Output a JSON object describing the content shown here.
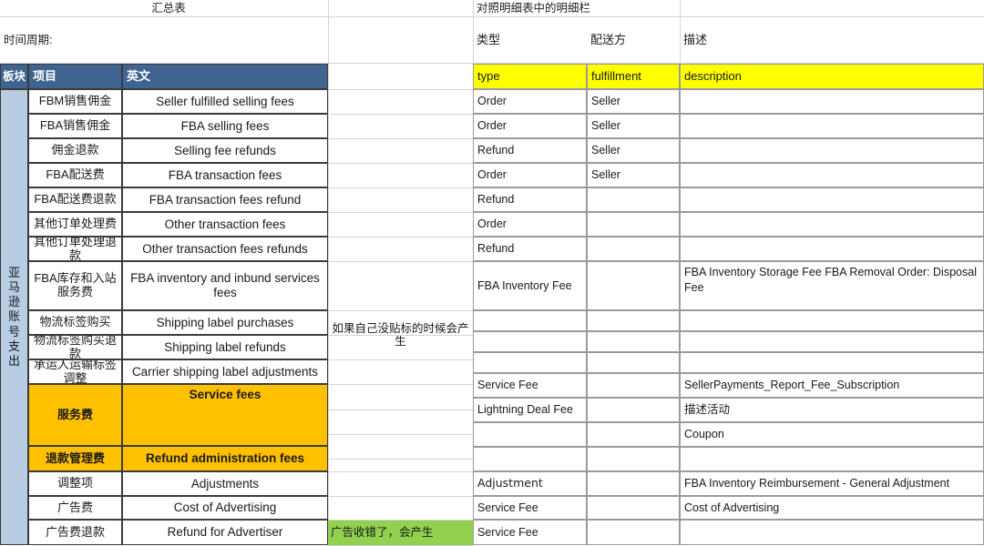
{
  "sheet": {
    "section_headers": {
      "summary_table": "汇总表",
      "detail_reference": "对照明细表中的明细栏",
      "time_period": "时间周期:"
    },
    "left_table": {
      "headers": {
        "block": "板块",
        "item": "项目",
        "english": "英文"
      },
      "block_label": "亚马逊账号支出",
      "rows": [
        {
          "item": "FBM销售佣金",
          "english": "Seller fulfilled selling fees",
          "fill": "white"
        },
        {
          "item": "FBA销售佣金",
          "english": "FBA selling fees",
          "fill": "white"
        },
        {
          "item": "佣金退款",
          "english": "Selling fee refunds",
          "fill": "white"
        },
        {
          "item": "FBA配送费",
          "english": "FBA transaction fees",
          "fill": "white"
        },
        {
          "item": "FBA配送费退款",
          "english": "FBA transaction fees refund",
          "fill": "white"
        },
        {
          "item": "其他订单处理费",
          "english": "Other transaction fees",
          "fill": "white"
        },
        {
          "item": "其他订单处理退款",
          "english": "Other transaction fees refunds",
          "fill": "white"
        },
        {
          "item": "FBA库存和入站服务费",
          "english": "FBA inventory and inbund services fees",
          "fill": "white"
        },
        {
          "item": "物流标签购买",
          "english": "Shipping label purchases",
          "fill": "white"
        },
        {
          "item": "物流标签购买退款",
          "english": "Shipping label refunds",
          "fill": "white"
        },
        {
          "item": "承运人运输标签调整",
          "english": "Carrier shipping label adjustments",
          "fill": "white"
        },
        {
          "item": "服务费",
          "english": "Service fees",
          "fill": "orange"
        },
        {
          "item": "退款管理费",
          "english": "Refund administration fees",
          "fill": "orange"
        },
        {
          "item": "调整项",
          "english": "Adjustments",
          "fill": "white"
        },
        {
          "item": "广告费",
          "english": "Cost of Advertising",
          "fill": "white"
        },
        {
          "item": "广告费退款",
          "english": "Refund for Advertiser",
          "fill": "white"
        }
      ]
    },
    "notes_column": {
      "shipping_label_note": "如果自己没贴标的时候会产生",
      "advertising_note": "广告收错了，会产生"
    },
    "right_table": {
      "cn_headers": {
        "type": "类型",
        "fulfillment": "配送方",
        "description": "描述"
      },
      "en_headers": {
        "type": "type",
        "fulfillment": "fulfillment",
        "description": "description"
      },
      "rows": [
        {
          "type": "Order",
          "fulfillment": "Seller",
          "description": ""
        },
        {
          "type": "Order",
          "fulfillment": "Seller",
          "description": ""
        },
        {
          "type": "Refund",
          "fulfillment": "Seller",
          "description": ""
        },
        {
          "type": "Order",
          "fulfillment": "Seller",
          "description": ""
        },
        {
          "type": "Refund",
          "fulfillment": "",
          "description": ""
        },
        {
          "type": "Order",
          "fulfillment": "",
          "description": ""
        },
        {
          "type": "Refund",
          "fulfillment": "",
          "description": ""
        },
        {
          "type": "FBA Inventory Fee",
          "fulfillment": "",
          "description": "FBA Inventory Storage Fee        FBA Removal Order: Disposal Fee"
        },
        {
          "type": "",
          "fulfillment": "",
          "description": ""
        },
        {
          "type": "",
          "fulfillment": "",
          "description": ""
        },
        {
          "type": "",
          "fulfillment": "",
          "description": ""
        },
        {
          "type": "Service Fee",
          "fulfillment": "",
          "description": "SellerPayments_Report_Fee_Subscription"
        },
        {
          "type": "Lightning Deal Fee",
          "fulfillment": "",
          "description": "描述活动"
        },
        {
          "type": "",
          "fulfillment": "",
          "description": "Coupon"
        },
        {
          "type": "",
          "fulfillment": "",
          "description": ""
        },
        {
          "type": "Adjustment",
          "fulfillment": "",
          "description": "FBA Inventory Reimbursement - General Adjustment"
        },
        {
          "type": "Service Fee",
          "fulfillment": "",
          "description": "Cost of Advertising"
        },
        {
          "type": "Service Fee",
          "fulfillment": "",
          "description": ""
        }
      ]
    },
    "colors": {
      "header_blue": "#3f6490",
      "block_light_blue": "#b8cce4",
      "orange": "#ffc000",
      "yellow": "#ffff00",
      "green": "#92d050"
    }
  }
}
